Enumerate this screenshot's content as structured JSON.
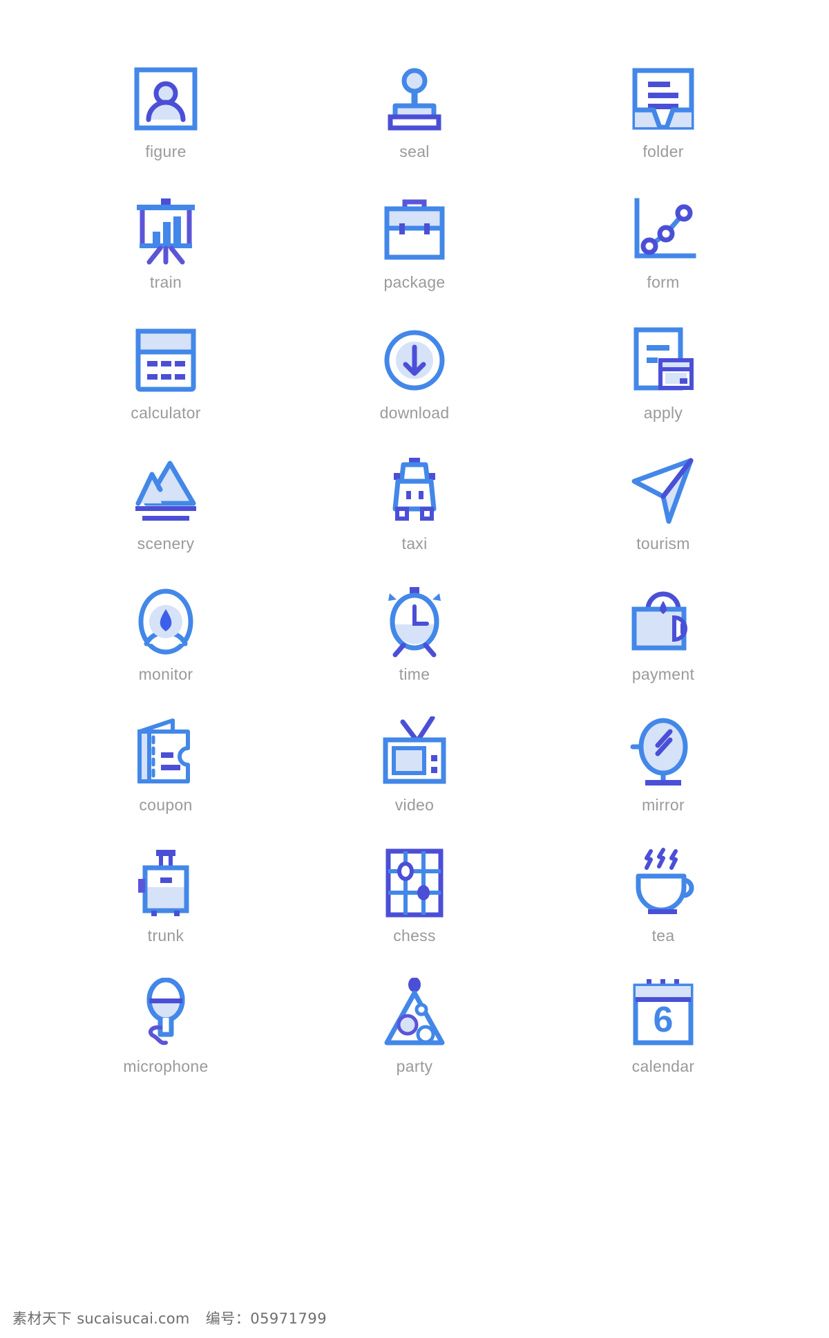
{
  "palette": {
    "primary_blue": "#4387e8",
    "deep_blue": "#4b4fd6",
    "fill_light": "#d6e2f8",
    "label_gray": "#9a9a9a",
    "background": "#ffffff"
  },
  "grid": {
    "columns": 3,
    "rows": 8,
    "total_icons": 24
  },
  "icons": [
    {
      "id": "figure",
      "label": "figure",
      "icon_name": "figure-icon"
    },
    {
      "id": "seal",
      "label": "seal",
      "icon_name": "seal-icon"
    },
    {
      "id": "folder",
      "label": "folder",
      "icon_name": "folder-icon"
    },
    {
      "id": "train",
      "label": "train",
      "icon_name": "train-icon"
    },
    {
      "id": "package",
      "label": "package",
      "icon_name": "package-icon"
    },
    {
      "id": "form",
      "label": "form",
      "icon_name": "form-icon"
    },
    {
      "id": "calculator",
      "label": "calculator",
      "icon_name": "calculator-icon"
    },
    {
      "id": "download",
      "label": "download",
      "icon_name": "download-icon"
    },
    {
      "id": "apply",
      "label": "apply",
      "icon_name": "apply-icon"
    },
    {
      "id": "scenery",
      "label": "scenery",
      "icon_name": "scenery-icon"
    },
    {
      "id": "taxi",
      "label": "taxi",
      "icon_name": "taxi-icon"
    },
    {
      "id": "tourism",
      "label": "tourism",
      "icon_name": "tourism-icon"
    },
    {
      "id": "monitor",
      "label": "monitor",
      "icon_name": "monitor-icon"
    },
    {
      "id": "time",
      "label": "time",
      "icon_name": "time-icon"
    },
    {
      "id": "payment",
      "label": "payment",
      "icon_name": "payment-icon"
    },
    {
      "id": "coupon",
      "label": "coupon",
      "icon_name": "coupon-icon"
    },
    {
      "id": "video",
      "label": "video",
      "icon_name": "video-icon"
    },
    {
      "id": "mirror",
      "label": "mirror",
      "icon_name": "mirror-icon"
    },
    {
      "id": "trunk",
      "label": "trunk",
      "icon_name": "trunk-icon"
    },
    {
      "id": "chess",
      "label": "chess",
      "icon_name": "chess-icon"
    },
    {
      "id": "tea",
      "label": "tea",
      "icon_name": "tea-icon"
    },
    {
      "id": "microphone",
      "label": "microphone",
      "icon_name": "microphone-icon"
    },
    {
      "id": "party",
      "label": "party",
      "icon_name": "party-icon"
    },
    {
      "id": "calendar",
      "label": "calendar",
      "icon_name": "calendar-icon"
    }
  ],
  "calendar_day": "6",
  "footer": {
    "brand": "素材天下",
    "site": "sucaisucai.com",
    "number_label": "编号：",
    "number": "05971799"
  }
}
